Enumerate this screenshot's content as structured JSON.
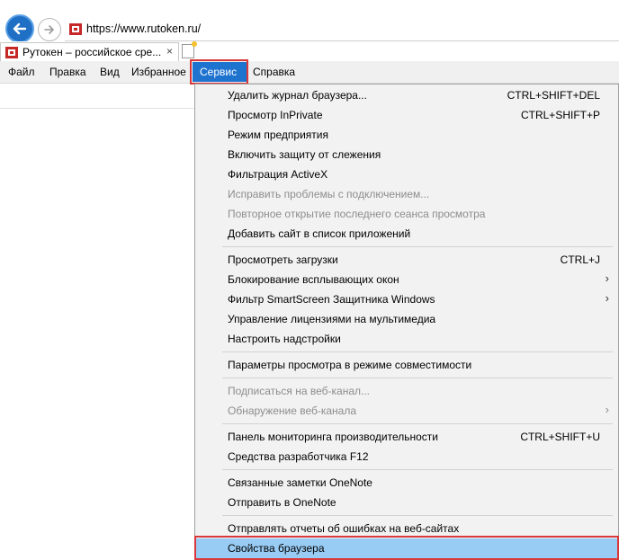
{
  "address_bar": {
    "url": "https://www.rutoken.ru/"
  },
  "tab": {
    "title": "Рутокен – российское сре...",
    "close_glyph": "×"
  },
  "menubar": {
    "file": "Файл",
    "edit": "Правка",
    "view": "Вид",
    "favorites": "Избранное",
    "tools": "Сервис",
    "help": "Справка"
  },
  "dropdown": {
    "items": [
      {
        "label": "Удалить журнал браузера...",
        "shortcut": "CTRL+SHIFT+DEL"
      },
      {
        "label": "Просмотр InPrivate",
        "shortcut": "CTRL+SHIFT+P"
      },
      {
        "label": "Режим предприятия"
      },
      {
        "label": "Включить защиту от слежения"
      },
      {
        "label": "Фильтрация ActiveX"
      },
      {
        "label": "Исправить проблемы с подключением...",
        "disabled": true
      },
      {
        "label": "Повторное открытие последнего сеанса просмотра",
        "disabled": true
      },
      {
        "label": "Добавить сайт в список приложений"
      },
      {
        "label": "Просмотреть загрузки",
        "shortcut": "CTRL+J"
      },
      {
        "label": "Блокирование всплывающих окон",
        "submenu": true
      },
      {
        "label": "Фильтр SmartScreen Защитника Windows",
        "submenu": true
      },
      {
        "label": "Управление лицензиями на мультимедиа"
      },
      {
        "label": "Настроить надстройки"
      },
      {
        "label": "Параметры просмотра в режиме совместимости"
      },
      {
        "label": "Подписаться на веб-канал...",
        "disabled": true
      },
      {
        "label": "Обнаружение веб-канала",
        "disabled": true,
        "submenu": true
      },
      {
        "label": "Панель мониторинга производительности",
        "shortcut": "CTRL+SHIFT+U"
      },
      {
        "label": "Средства разработчика F12"
      },
      {
        "label": "Связанные заметки OneNote"
      },
      {
        "label": "Отправить в OneNote"
      },
      {
        "label": "Отправлять отчеты об ошибках на веб-сайтах"
      },
      {
        "label": "Свойства браузера",
        "highlighted": true
      }
    ],
    "submenu_glyph": "›"
  },
  "colors": {
    "menu_active": "#1e73cf",
    "item_highlight": "#99ccf5",
    "callout_border": "#d9383b",
    "back_button": "#1f6fc5"
  }
}
